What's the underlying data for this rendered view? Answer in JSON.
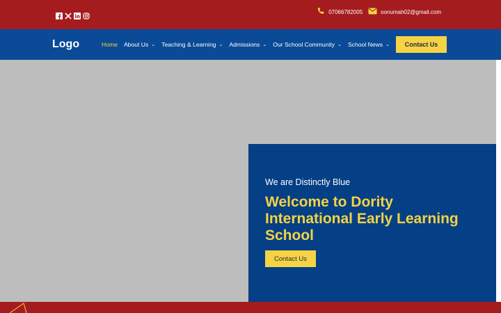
{
  "colors": {
    "topbar": "#a51c1f",
    "navbar": "#0a4a97",
    "accent": "#f5d342",
    "card": "#053f86",
    "hero": "#bdbdbd"
  },
  "social": [
    "facebook-icon",
    "x-twitter-icon",
    "linkedin-icon",
    "instagram-icon"
  ],
  "contact": {
    "phone_icon": "phone-icon",
    "phone": "07066782005",
    "email_icon": "envelope-icon",
    "email": "oonumah02@gmail.com"
  },
  "header": {
    "logo": "Logo",
    "nav": [
      {
        "label": "Home",
        "active": true,
        "dropdown": false
      },
      {
        "label": "About Us",
        "active": false,
        "dropdown": true
      },
      {
        "label": "Teaching & Learning",
        "active": false,
        "dropdown": true
      },
      {
        "label": "Admissions",
        "active": false,
        "dropdown": true
      },
      {
        "label": "Our School Community",
        "active": false,
        "dropdown": true
      },
      {
        "label": "School News",
        "active": false,
        "dropdown": true
      }
    ],
    "cta": "Contact Us"
  },
  "hero": {
    "kicker": "We are Distinctly Blue",
    "headline": "Welcome to Dority International Early Learning School",
    "cta": "Contact Us"
  }
}
